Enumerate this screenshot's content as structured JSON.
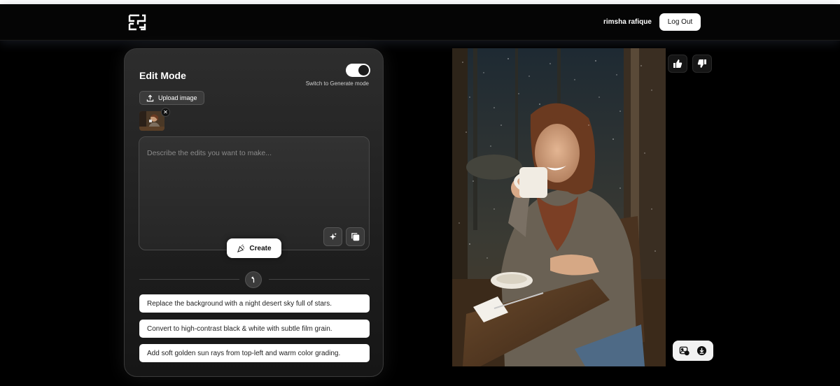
{
  "header": {
    "logo_icon": "brand-logo-icon",
    "username": "rimsha rafique",
    "logout_label": "Log Out"
  },
  "panel": {
    "title": "Edit Mode",
    "toggle_label": "Switch to Generate mode",
    "toggle_on": true,
    "upload_label": "Upload image",
    "prompt_placeholder": "Describe the edits you want to make...",
    "prompt_value": "",
    "create_label": "Create",
    "suggestions": [
      "Replace the background with a night desert sky full of stars.",
      "Convert to high-contrast black & white with subtle film grain.",
      "Add soft golden sun rays from top-left and warm color grading."
    ]
  },
  "image_actions": {
    "like_icon": "thumbs-up-icon",
    "dislike_icon": "thumbs-down-icon",
    "use_as_input_icon": "image-edit-icon",
    "download_icon": "download-icon"
  },
  "colors": {
    "background": "#000000",
    "panel": "#262626",
    "accent": "#ffffff"
  }
}
